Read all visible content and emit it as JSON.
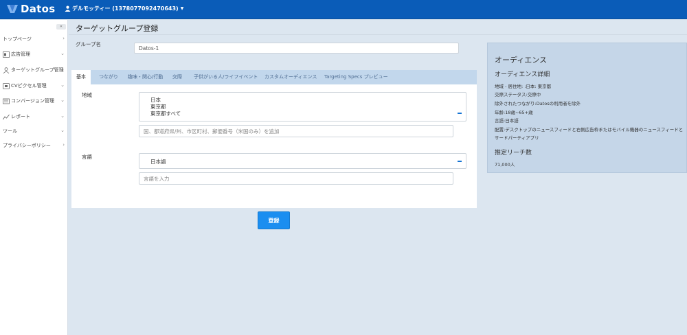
{
  "app": {
    "brand": "Datos"
  },
  "header": {
    "user_label": "デルモッティー (1378077092470643)"
  },
  "sidebar": {
    "collapse_label": "«",
    "items": [
      {
        "label": "トップページ",
        "icon": "none"
      },
      {
        "label": "広告管理",
        "icon": "ad-icon"
      },
      {
        "label": "ターゲットグループ管理",
        "icon": "user-icon"
      },
      {
        "label": "CVピクセル管理",
        "icon": "pixel-icon"
      },
      {
        "label": "コンバージョン管理",
        "icon": "conversion-icon"
      },
      {
        "label": "レポート",
        "icon": "chart-icon"
      },
      {
        "label": "ツール",
        "icon": "none"
      },
      {
        "label": "プライバシーポリシー",
        "icon": "none"
      }
    ]
  },
  "page": {
    "title": "ターゲットグループ登録",
    "group_name_label": "グループ名",
    "group_name_value": "Datos-1"
  },
  "tabs": [
    {
      "label": "基本",
      "active": true
    },
    {
      "label": "つながり",
      "active": false
    },
    {
      "label": "趣味・関心/行動",
      "active": false
    },
    {
      "label": "交際",
      "active": false
    },
    {
      "label": "子供がいる人/ライフイベント",
      "active": false
    },
    {
      "label": "カスタムオーディエンス",
      "active": false
    },
    {
      "label": "Targeting Specs プレビュー",
      "active": false
    }
  ],
  "basic": {
    "region_label": "地域",
    "region_lines": [
      "日本",
      "東京都",
      "東京都すべて"
    ],
    "region_placeholder": "国、都道府県/州、市区町村、郵便番号（米国のみ）を追加",
    "language_label": "言語",
    "language_selected": "日本語",
    "language_placeholder": "言語を入力"
  },
  "submit_label": "登録",
  "audience": {
    "title": "オーディエンス",
    "detail_title": "オーディエンス詳細",
    "details": [
      "地域 - 居住地: :日本: 東京都",
      "交際ステータス:交際中",
      "除外されたつながり:Datosの利用者を除外",
      "年齢:18歳~65+歳",
      "言語:日本語",
      "配置:デスクトップのニュースフィードと右側広告枠またはモバイル機器のニュースフィードと",
      "サードパーティアプリ"
    ],
    "reach_title": "推定リーチ数",
    "reach_value": "71,000人"
  },
  "colors": {
    "topbar": "#0a5cb8",
    "accent_button": "#1b8ef0",
    "page_bg": "#dce6f0",
    "tab_bar_bg": "#c2d7ec",
    "audience_panel_bg": "#c5d6e8"
  }
}
